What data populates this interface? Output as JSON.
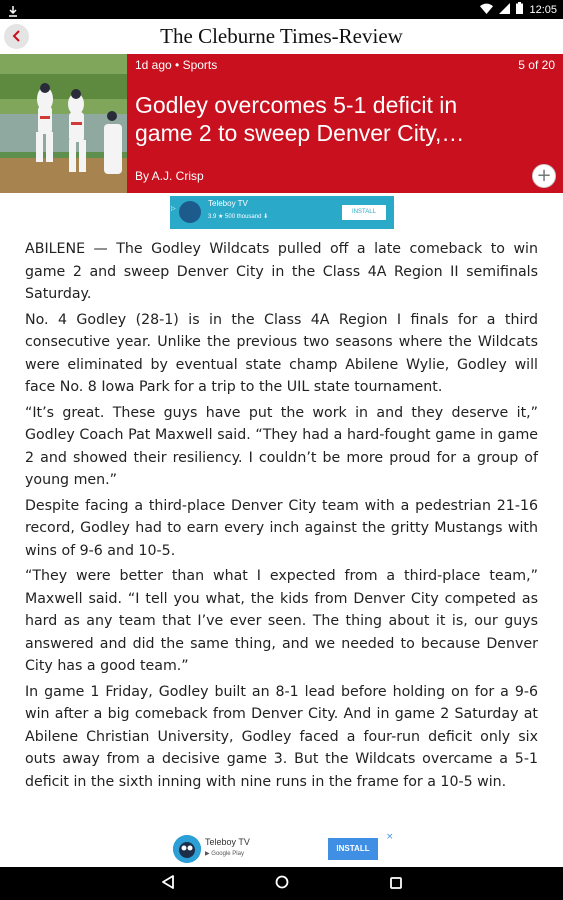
{
  "status_bar": {
    "time": "12:05",
    "icons": [
      "download-icon",
      "wifi-icon",
      "signal-icon",
      "battery-icon"
    ]
  },
  "header": {
    "publication": "The Cleburne Times-Review",
    "back_icon": "chevron-left-icon"
  },
  "hero": {
    "meta": "1d ago • Sports",
    "counter": "5 of 20",
    "headline": "Godley overcomes 5-1 deficit in\ngame 2 to sweep Denver City,…",
    "byline": "By A.J. Crisp",
    "plus_icon": "plus-icon",
    "card_color": "#c8101e"
  },
  "ad_top": {
    "title": "Teleboy TV",
    "rating": "3.9 ★ 500 thousand ⬇",
    "install": "INSTALL",
    "color": "#2aa9c9"
  },
  "article": {
    "paragraphs": [
      "ABILENE — The Godley Wildcats pulled off a late comeback to win game 2 and sweep Denver City in the Class 4A Region II semifinals Saturday.",
      "No. 4 Godley (28-1) is in the Class 4A Region I finals for a third consecutive year. Unlike the previous two seasons where the Wildcats were eliminated by eventual state champ Abilene Wylie, Godley will face No. 8 Iowa Park for a trip to the UIL state tournament.",
      "“It’s great. These guys have put the work in and they deserve it,” Godley Coach Pat Maxwell said. “They had a hard-fought game in game 2 and showed their resiliency. I couldn’t be more proud for a group of young men.”",
      "Despite facing a third-place Denver City team with a pedestrian 21-16 record, Godley had to earn every inch against the gritty Mustangs with wins of 9-6 and 10-5.",
      "“They were better than what I expected from a third-place team,” Maxwell said. “I tell you what, the kids from Denver City competed as hard as any team that I’ve ever seen. The thing about it is, our guys answered and did the same thing, and we needed to because Denver City has a good team.”",
      "In game 1 Friday, Godley built an 8-1 lead before holding on for a 9-6 win after a big comeback from Denver City. And in game 2 Saturday at Abilene Christian University, Godley faced a four-run deficit only six outs away from a decisive game 3. But the Wildcats overcame a 5-1 deficit in the sixth inning with nine runs in the frame for a 10-5 win."
    ]
  },
  "ad_bottom": {
    "title": "Teleboy TV",
    "store": "▶ Google Play",
    "install": "INSTALL",
    "close": "×",
    "button_color": "#3f8fe4"
  },
  "nav_bar": {
    "icons": [
      "back-triangle-icon",
      "home-circle-icon",
      "recents-square-icon"
    ]
  }
}
